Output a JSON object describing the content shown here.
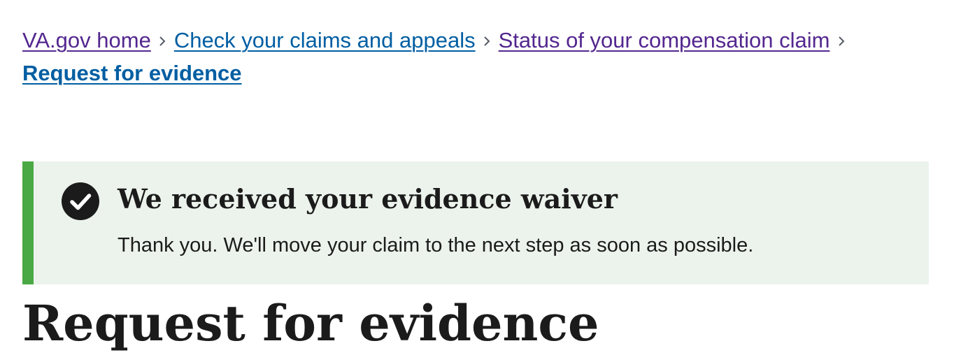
{
  "breadcrumb": {
    "items": [
      {
        "label": "VA.gov home"
      },
      {
        "label": "Check your claims and appeals"
      },
      {
        "label": "Status of your compensation claim"
      },
      {
        "label": "Request for evidence"
      }
    ],
    "separator_icon": "chevron-right-icon"
  },
  "alert": {
    "status": "success",
    "icon": "check-circle-icon",
    "heading": "We received your evidence waiver",
    "body": "Thank you. We'll move your claim to the next step as soon as possible.",
    "accent_color": "#4aa944",
    "background_color": "#ecf3ec"
  },
  "page": {
    "title": "Request for evidence"
  },
  "colors": {
    "link_visited": "#54278f",
    "link": "#005ea2",
    "text": "#1b1b1b"
  }
}
